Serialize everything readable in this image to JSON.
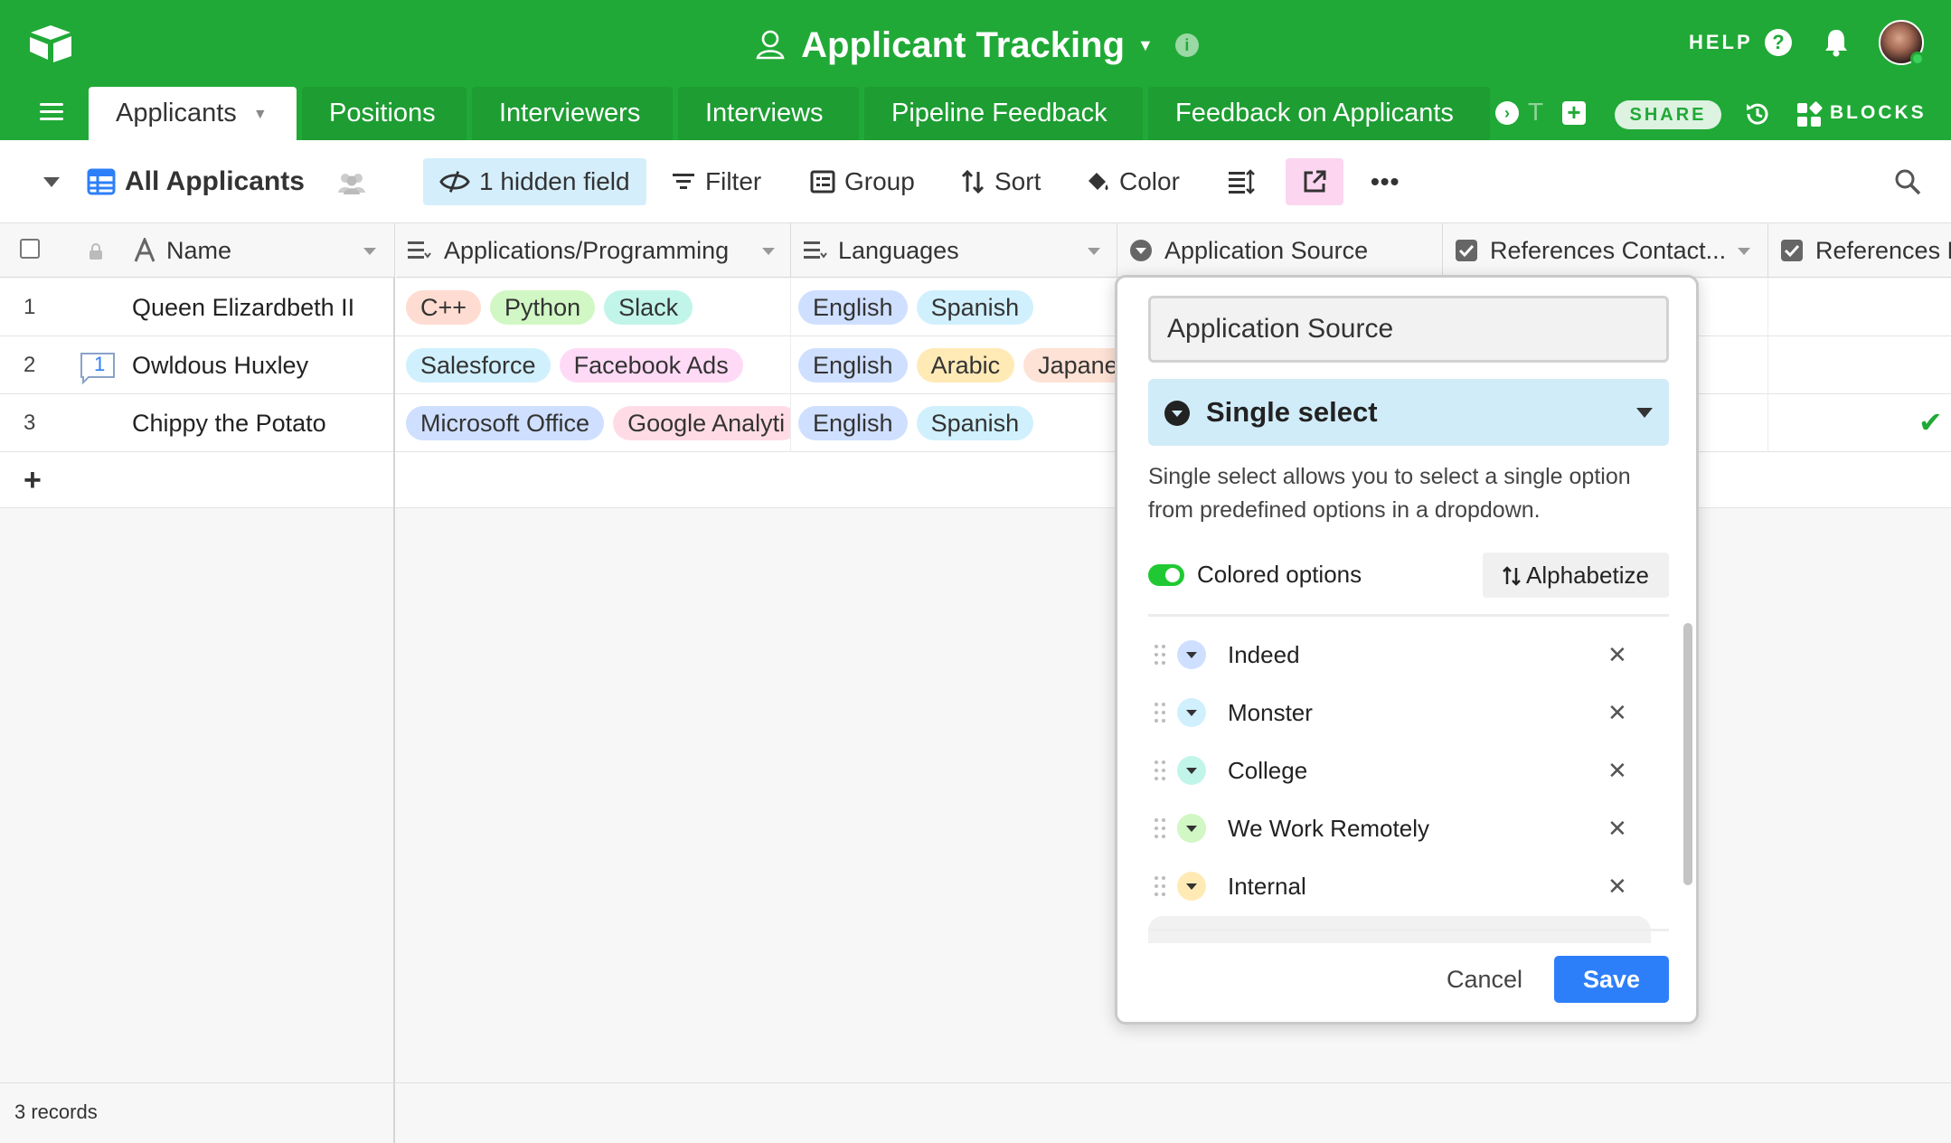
{
  "header": {
    "base_title": "Applicant Tracking",
    "help_label": "HELP",
    "share_label": "SHARE",
    "blocks_label": "BLOCKS",
    "tab_fade_text": "T"
  },
  "tabs": [
    {
      "label": "Applicants",
      "active": true
    },
    {
      "label": "Positions"
    },
    {
      "label": "Interviewers"
    },
    {
      "label": "Interviews"
    },
    {
      "label": "Pipeline Feedback"
    },
    {
      "label": "Feedback on Applicants"
    }
  ],
  "viewbar": {
    "view_name": "All Applicants",
    "hidden_fields": "1 hidden field",
    "filter": "Filter",
    "group": "Group",
    "sort": "Sort",
    "color": "Color"
  },
  "columns": {
    "name": "Name",
    "programming": "Applications/Programming",
    "languages": "Languages",
    "source": "Application Source",
    "ref_contacted": "References Contact...",
    "ref_cut": "References R"
  },
  "rows": [
    {
      "num": "1",
      "name": "Queen Elizardbeth II",
      "programming": [
        {
          "text": "C++",
          "color": "#ffdcd2"
        },
        {
          "text": "Python",
          "color": "#d1f7c4"
        },
        {
          "text": "Slack",
          "color": "#c2f5e9"
        }
      ],
      "languages": [
        {
          "text": "English",
          "color": "#cfdfff"
        },
        {
          "text": "Spanish",
          "color": "#d0f0fd"
        }
      ]
    },
    {
      "num": "2",
      "name": "Owldous Huxley",
      "comment_count": "1",
      "programming": [
        {
          "text": "Salesforce",
          "color": "#d0f0fd"
        },
        {
          "text": "Facebook Ads",
          "color": "#ffdaf6"
        }
      ],
      "languages": [
        {
          "text": "English",
          "color": "#cfdfff"
        },
        {
          "text": "Arabic",
          "color": "#ffeab6"
        },
        {
          "text": "Japane",
          "color": "#fee2d5"
        }
      ]
    },
    {
      "num": "3",
      "name": "Chippy the Potato",
      "programming": [
        {
          "text": "Microsoft Office",
          "color": "#cfdfff"
        },
        {
          "text": "Google Analyti",
          "color": "#ffdce5"
        }
      ],
      "languages": [
        {
          "text": "English",
          "color": "#cfdfff"
        },
        {
          "text": "Spanish",
          "color": "#d0f0fd"
        }
      ]
    }
  ],
  "add_row_label": "+",
  "records_count": "3 records",
  "field_editor": {
    "field_name": "Application Source",
    "field_type": "Single select",
    "description": "Single select allows you to select a single option from predefined options in a dropdown.",
    "colored_options_label": "Colored options",
    "colored_options_on": true,
    "alphabetize_label": "Alphabetize",
    "options": [
      {
        "label": "Indeed",
        "color": "#cfdfff"
      },
      {
        "label": "Monster",
        "color": "#d0f0fd"
      },
      {
        "label": "College",
        "color": "#c2f5e9"
      },
      {
        "label": "We Work Remotely",
        "color": "#d1f7c4"
      },
      {
        "label": "Internal",
        "color": "#ffeab6"
      }
    ],
    "remove_glyph": "✕",
    "cancel_label": "Cancel",
    "save_label": "Save"
  },
  "colors": {
    "brand_green": "#20a936",
    "save_blue": "#2d7ff9",
    "hidden_field_bg": "#d4eefb",
    "type_select_bg": "#d1ecf9"
  }
}
